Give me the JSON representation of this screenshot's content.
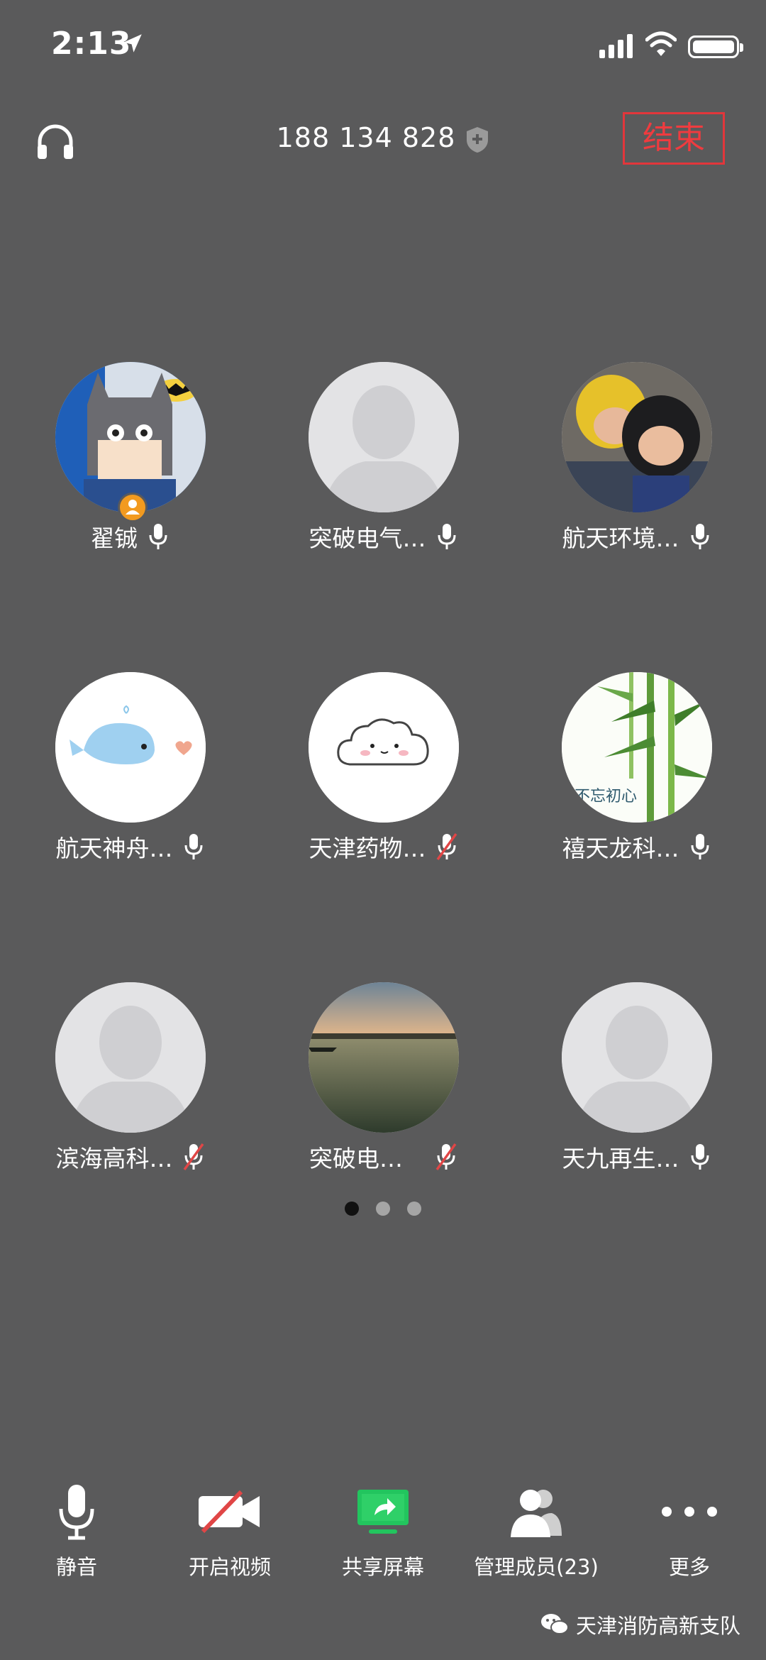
{
  "status_bar": {
    "time": "2:13"
  },
  "header": {
    "meeting_id": "188 134 828",
    "end_label": "结束"
  },
  "participants": [
    {
      "name": "翟铖",
      "mic": "on",
      "avatar": "batman-drawing",
      "host": true
    },
    {
      "name": "突破电气…",
      "mic": "on",
      "avatar": "default-silhouette"
    },
    {
      "name": "航天环境…",
      "mic": "on",
      "avatar": "helmet-photo"
    },
    {
      "name": "航天神舟…",
      "mic": "on",
      "avatar": "whale-cartoon"
    },
    {
      "name": "天津药物…",
      "mic": "muted",
      "avatar": "cloud-cartoon"
    },
    {
      "name": "禧天龙科…",
      "mic": "on",
      "avatar": "bamboo-painting",
      "avatar_text": "不忘初心"
    },
    {
      "name": "滨海高科…",
      "mic": "muted",
      "avatar": "default-silhouette"
    },
    {
      "name": "突破电…",
      "mic": "muted",
      "avatar": "lake-photo"
    },
    {
      "name": "天九再生…",
      "mic": "on",
      "avatar": "default-silhouette"
    }
  ],
  "pagination": {
    "pages": 3,
    "current": 1
  },
  "toolbar": {
    "mute": "静音",
    "video": "开启视频",
    "share": "共享屏幕",
    "members": "管理成员(23)",
    "more": "更多"
  },
  "watermark": "天津消防高新支队",
  "colors": {
    "background": "#5a5a5b",
    "end_red": "#e2363b",
    "share_green": "#22c55e",
    "host_orange": "#f29a1f",
    "mute_red": "#e04646"
  }
}
